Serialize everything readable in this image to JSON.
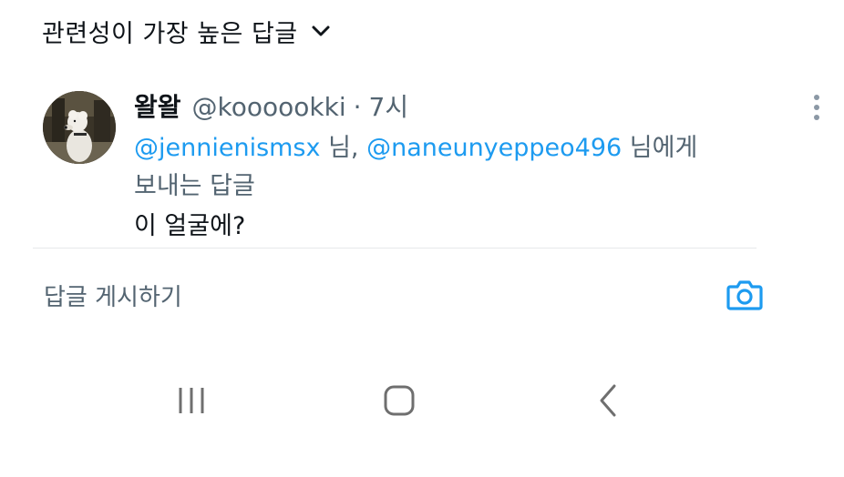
{
  "sort_header": {
    "label": "관련성이 가장 높은 답글",
    "icon": "chevron-down-icon"
  },
  "tweet": {
    "display_name": "왈왈",
    "handle": "@koooookki",
    "separator": "·",
    "time": "7시",
    "more_icon": "more-vertical-icon",
    "reply_to": {
      "mention_1": "@jennienismsx",
      "mid_text": " 님, ",
      "mention_2": "@naneunyeppeo496",
      "suffix_1": " 님에게",
      "suffix_2": "보내는 답글"
    },
    "text": "이 얼굴에?"
  },
  "composer": {
    "placeholder": "답글 게시하기",
    "camera_icon": "camera-icon"
  },
  "navbar": {
    "recents_icon": "recents-icon",
    "home_icon": "home-icon",
    "back_icon": "back-icon"
  },
  "colors": {
    "accent": "#1d9bf0",
    "text_primary": "#0f1419",
    "text_secondary": "#536471",
    "divider": "#e7e9ea"
  }
}
